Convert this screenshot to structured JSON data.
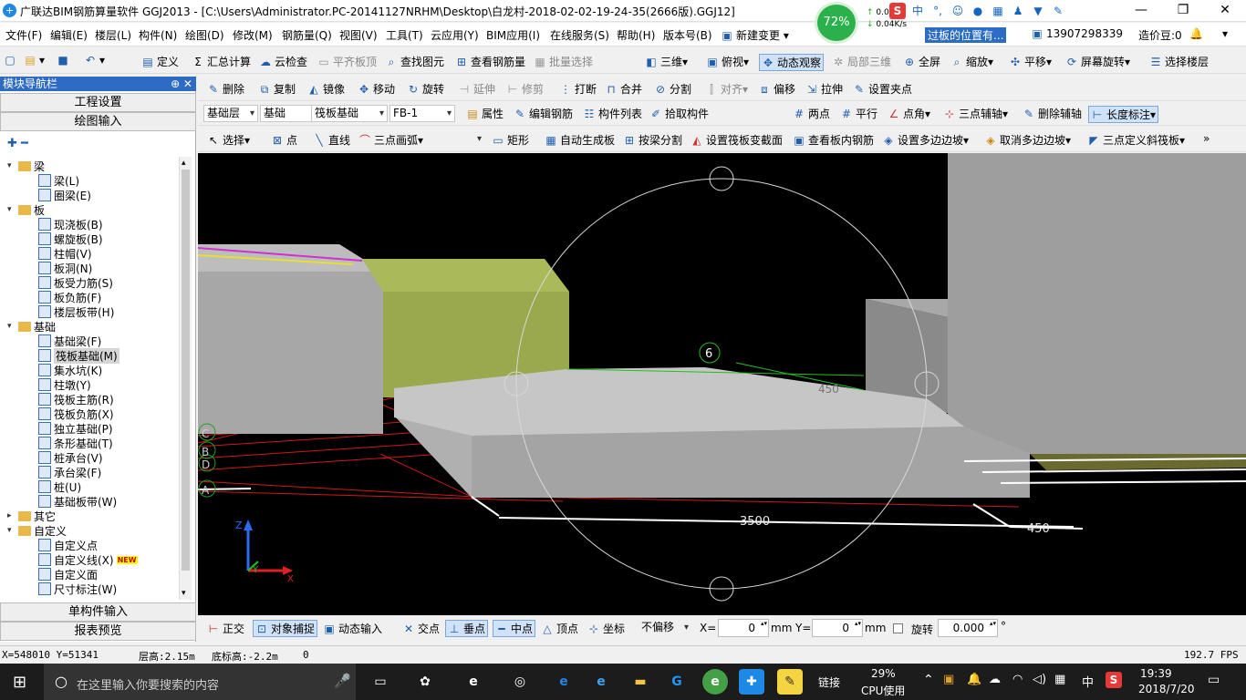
{
  "window": {
    "title": "广联达BIM钢筋算量软件 GGJ2013 - [C:\\Users\\Administrator.PC-20141127NRHM\\Desktop\\白龙村-2018-02-02-19-24-35(2666版).GGJ12]",
    "logo": "+",
    "controls": [
      "—",
      "❐",
      "✕"
    ]
  },
  "perf": {
    "percent": "72%",
    "up": "0.0",
    "down": "0.04K/s"
  },
  "menu": {
    "items": [
      "文件(F)",
      "编辑(E)",
      "楼层(L)",
      "构件(N)",
      "绘图(D)",
      "修改(M)",
      "钢筋量(Q)",
      "视图(V)",
      "工具(T)",
      "云应用(Y)",
      "BIM应用(I)",
      "在线服务(S)",
      "帮助(H)",
      "版本号(B)"
    ],
    "new_change": "新建变更",
    "notice": "过板的位置有...",
    "phone": "13907298339",
    "beans": "造价豆:0"
  },
  "toolbar1": {
    "define": "定义",
    "sum": "汇总计算",
    "cloud_check": "云检查",
    "flat_top": "平齐板顶",
    "find": "查找图元",
    "view_rebar": "查看钢筋量",
    "batch": "批量选择",
    "view3d": "三维",
    "top_view": "俯视",
    "dynamic": "动态观察",
    "local3d": "局部三维",
    "fullscreen": "全屏",
    "zoom": "缩放",
    "pan": "平移",
    "rotate_screen": "屏幕旋转",
    "select_floor": "选择楼层"
  },
  "toolbar2": {
    "delete": "删除",
    "copy": "复制",
    "mirror": "镜像",
    "move": "移动",
    "rotate": "旋转",
    "extend": "延伸",
    "trim": "修剪",
    "break": "打断",
    "merge": "合并",
    "split": "分割",
    "align": "对齐",
    "offset": "偏移",
    "stretch": "拉伸",
    "grip": "设置夹点"
  },
  "toolbar3": {
    "floor": "基础层",
    "category": "基础",
    "type": "筏板基础",
    "element": "FB-1",
    "props": "属性",
    "edit_rebar": "编辑钢筋",
    "list": "构件列表",
    "pick": "拾取构件",
    "two_point": "两点",
    "parallel": "平行",
    "point_angle": "点角",
    "three_aux": "三点辅轴",
    "del_aux": "删除辅轴",
    "length_dim": "长度标注"
  },
  "toolbar4": {
    "select": "选择",
    "point": "点",
    "line": "直线",
    "arc": "三点画弧",
    "rect": "矩形",
    "auto_gen": "自动生成板",
    "split_by_beam": "按梁分割",
    "set_section": "设置筏板变截面",
    "view_rebar": "查看板内钢筋",
    "set_slope": "设置多边边坡",
    "cancel_slope": "取消多边边坡",
    "three_slope": "三点定义斜筏板"
  },
  "nav": {
    "header": "模块导航栏",
    "pin": "⊕ ✕",
    "project_settings": "工程设置",
    "drawing_input": "绘图输入",
    "single_input": "单构件输入",
    "report": "报表预览",
    "tree": [
      {
        "type": "folder",
        "label": "梁",
        "depth": 0
      },
      {
        "type": "leaf",
        "label": "梁(L)",
        "depth": 1
      },
      {
        "type": "leaf",
        "label": "圈梁(E)",
        "depth": 1
      },
      {
        "type": "folder",
        "label": "板",
        "depth": 0
      },
      {
        "type": "leaf",
        "label": "现浇板(B)",
        "depth": 1
      },
      {
        "type": "leaf",
        "label": "螺旋板(B)",
        "depth": 1
      },
      {
        "type": "leaf",
        "label": "柱帽(V)",
        "depth": 1
      },
      {
        "type": "leaf",
        "label": "板洞(N)",
        "depth": 1
      },
      {
        "type": "leaf",
        "label": "板受力筋(S)",
        "depth": 1
      },
      {
        "type": "leaf",
        "label": "板负筋(F)",
        "depth": 1
      },
      {
        "type": "leaf",
        "label": "楼层板带(H)",
        "depth": 1
      },
      {
        "type": "folder",
        "label": "基础",
        "depth": 0
      },
      {
        "type": "leaf",
        "label": "基础梁(F)",
        "depth": 1
      },
      {
        "type": "leaf",
        "label": "筏板基础(M)",
        "depth": 1,
        "selected": true
      },
      {
        "type": "leaf",
        "label": "集水坑(K)",
        "depth": 1
      },
      {
        "type": "leaf",
        "label": "柱墩(Y)",
        "depth": 1
      },
      {
        "type": "leaf",
        "label": "筏板主筋(R)",
        "depth": 1
      },
      {
        "type": "leaf",
        "label": "筏板负筋(X)",
        "depth": 1
      },
      {
        "type": "leaf",
        "label": "独立基础(P)",
        "depth": 1
      },
      {
        "type": "leaf",
        "label": "条形基础(T)",
        "depth": 1
      },
      {
        "type": "leaf",
        "label": "桩承台(V)",
        "depth": 1
      },
      {
        "type": "leaf",
        "label": "承台梁(F)",
        "depth": 1
      },
      {
        "type": "leaf",
        "label": "桩(U)",
        "depth": 1
      },
      {
        "type": "leaf",
        "label": "基础板带(W)",
        "depth": 1
      },
      {
        "type": "folder",
        "label": "其它",
        "depth": 0,
        "collapsed": true
      },
      {
        "type": "folder",
        "label": "自定义",
        "depth": 0
      },
      {
        "type": "leaf",
        "label": "自定义点",
        "depth": 1
      },
      {
        "type": "leaf",
        "label": "自定义线(X)",
        "depth": 1,
        "badge": "NEW"
      },
      {
        "type": "leaf",
        "label": "自定义面",
        "depth": 1
      },
      {
        "type": "leaf",
        "label": "尺寸标注(W)",
        "depth": 1
      }
    ]
  },
  "viewport": {
    "dims": {
      "main": "3500",
      "side": "450",
      "top": "450"
    },
    "axis_labels": [
      "6",
      "C",
      "B",
      "D",
      "A"
    ],
    "axes": {
      "z": "Z",
      "y": "Y",
      "x": "X"
    }
  },
  "bottombar": {
    "ortho": "正交",
    "snap": "对象捕捉",
    "dyn_input": "动态输入",
    "intersect": "交点",
    "perp": "垂点",
    "mid": "中点",
    "vertex": "顶点",
    "coord": "坐标",
    "no_offset": "不偏移",
    "x_label": "X=",
    "x_val": "0",
    "mm1": "mm",
    "y_label": "Y=",
    "y_val": "0",
    "mm2": "mm",
    "rotate": "旋转",
    "rot_val": "0.000",
    "deg": "°"
  },
  "status": {
    "coords": "X=548010 Y=51341",
    "floor_h": "层高:2.15m",
    "base_h": "底标高:-2.2m",
    "zero": "0",
    "fps": "192.7 FPS"
  },
  "taskbar": {
    "search": "在这里输入你要搜索的内容",
    "link": "链接",
    "cpu_pct": "29%",
    "cpu_label": "CPU使用",
    "ime": "中",
    "time": "19:39",
    "date": "2018/7/20"
  }
}
